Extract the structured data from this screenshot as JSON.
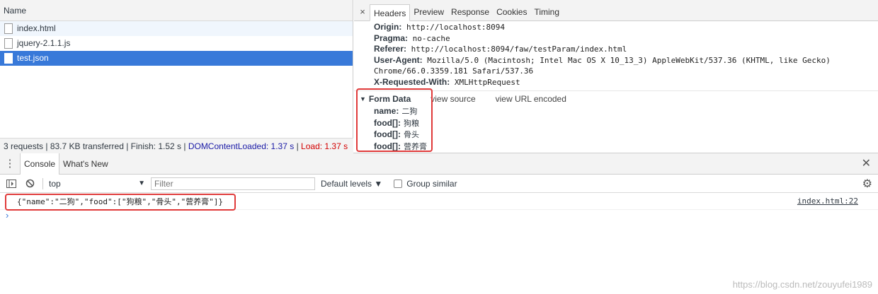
{
  "network": {
    "name_header": "Name",
    "requests": [
      {
        "name": "index.html"
      },
      {
        "name": "jquery-2.1.1.js"
      },
      {
        "name": "test.json"
      }
    ],
    "status": {
      "summary": "3 requests | 83.7 KB transferred | Finish: 1.52 s | ",
      "dom_loaded": "DOMContentLoaded: 1.37 s",
      "divider": " | ",
      "load": "Load: 1.37 s"
    }
  },
  "details": {
    "close": "×",
    "tabs": [
      "Headers",
      "Preview",
      "Response",
      "Cookies",
      "Timing"
    ],
    "headers": [
      {
        "key": "Origin:",
        "value": "http://localhost:8094"
      },
      {
        "key": "Pragma:",
        "value": "no-cache"
      },
      {
        "key": "Referer:",
        "value": "http://localhost:8094/faw/testParam/index.html"
      },
      {
        "key": "User-Agent:",
        "value": "Mozilla/5.0 (Macintosh; Intel Mac OS X 10_13_3) AppleWebKit/537.36 (KHTML, like Gecko) Chrome/66.0.3359.181 Safari/537.36"
      },
      {
        "key": "X-Requested-With:",
        "value": "XMLHttpRequest"
      }
    ],
    "form_data": {
      "title": "Form Data",
      "view_source": "view source",
      "view_url": "view URL encoded",
      "rows": [
        {
          "key": "name:",
          "value": "二狗"
        },
        {
          "key": "food[]:",
          "value": "狗粮"
        },
        {
          "key": "food[]:",
          "value": "骨头"
        },
        {
          "key": "food[]:",
          "value": "营养膏"
        }
      ]
    }
  },
  "console": {
    "tabs": [
      "Console",
      "What's New"
    ],
    "context": "top",
    "filter_placeholder": "Filter",
    "levels": "Default levels ▼",
    "group_similar": "Group similar",
    "log": {
      "message": "{\"name\":\"二狗\",\"food\":[\"狗粮\",\"骨头\",\"营养膏\"]}",
      "source": "index.html:22"
    },
    "prompt": "›"
  },
  "watermark": "https://blog.csdn.net/zouyufei1989",
  "colors": {
    "selection": "#3879d9",
    "highlight": "#e03a3a",
    "dom_loaded": "#1a1aa6",
    "load": "#d30000"
  }
}
